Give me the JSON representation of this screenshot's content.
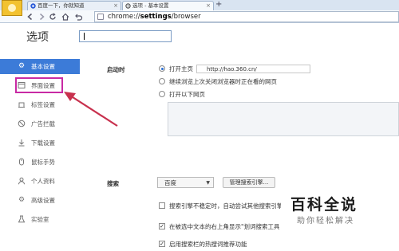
{
  "tabs": [
    {
      "title": "百度一下，你就知道",
      "close": "×"
    },
    {
      "title": "选项 - 基本设置",
      "close": "×"
    }
  ],
  "new_tab_label": "+",
  "toolbar": {
    "url_scheme": "chrome://",
    "url_bold": "settings",
    "url_rest": "/browser"
  },
  "page": {
    "title": "选项",
    "search_value": ""
  },
  "sidebar": {
    "items": [
      {
        "label": "基本设置",
        "icon": "gear-icon"
      },
      {
        "label": "界面设置",
        "icon": "window-icon"
      },
      {
        "label": "标签设置",
        "icon": "tab-icon"
      },
      {
        "label": "广告拦截",
        "icon": "block-icon"
      },
      {
        "label": "下载设置",
        "icon": "download-icon"
      },
      {
        "label": "鼠标手势",
        "icon": "mouse-icon"
      },
      {
        "label": "个人资料",
        "icon": "person-icon"
      },
      {
        "label": "高级设置",
        "icon": "advanced-gear-icon"
      },
      {
        "label": "实验室",
        "icon": "lab-icon"
      }
    ],
    "active_color": "#3c7bd8"
  },
  "startup": {
    "label": "启动时",
    "options": [
      "打开主页",
      "继续浏览上次关闭浏览器时正在看的网页",
      "打开以下网页"
    ],
    "selected": 0,
    "homepage_url": "http://hao.360.cn/"
  },
  "search": {
    "label": "搜索",
    "engine": "百度",
    "manage_button": "管理搜索引擎...",
    "checkboxes": [
      {
        "label": "搜索引擎不稳定时，自动尝试其他搜索引擎",
        "checked": false
      },
      {
        "label": "在被选中文本的右上角显示\"划词搜索工具条\"",
        "checked": true
      },
      {
        "label": "启用搜索栏的热搜词推荐功能",
        "checked": true
      }
    ]
  },
  "watermark": {
    "title": "百科全说",
    "subtitle": "助你轻松解决"
  },
  "annotation_color": "#c82aa4"
}
